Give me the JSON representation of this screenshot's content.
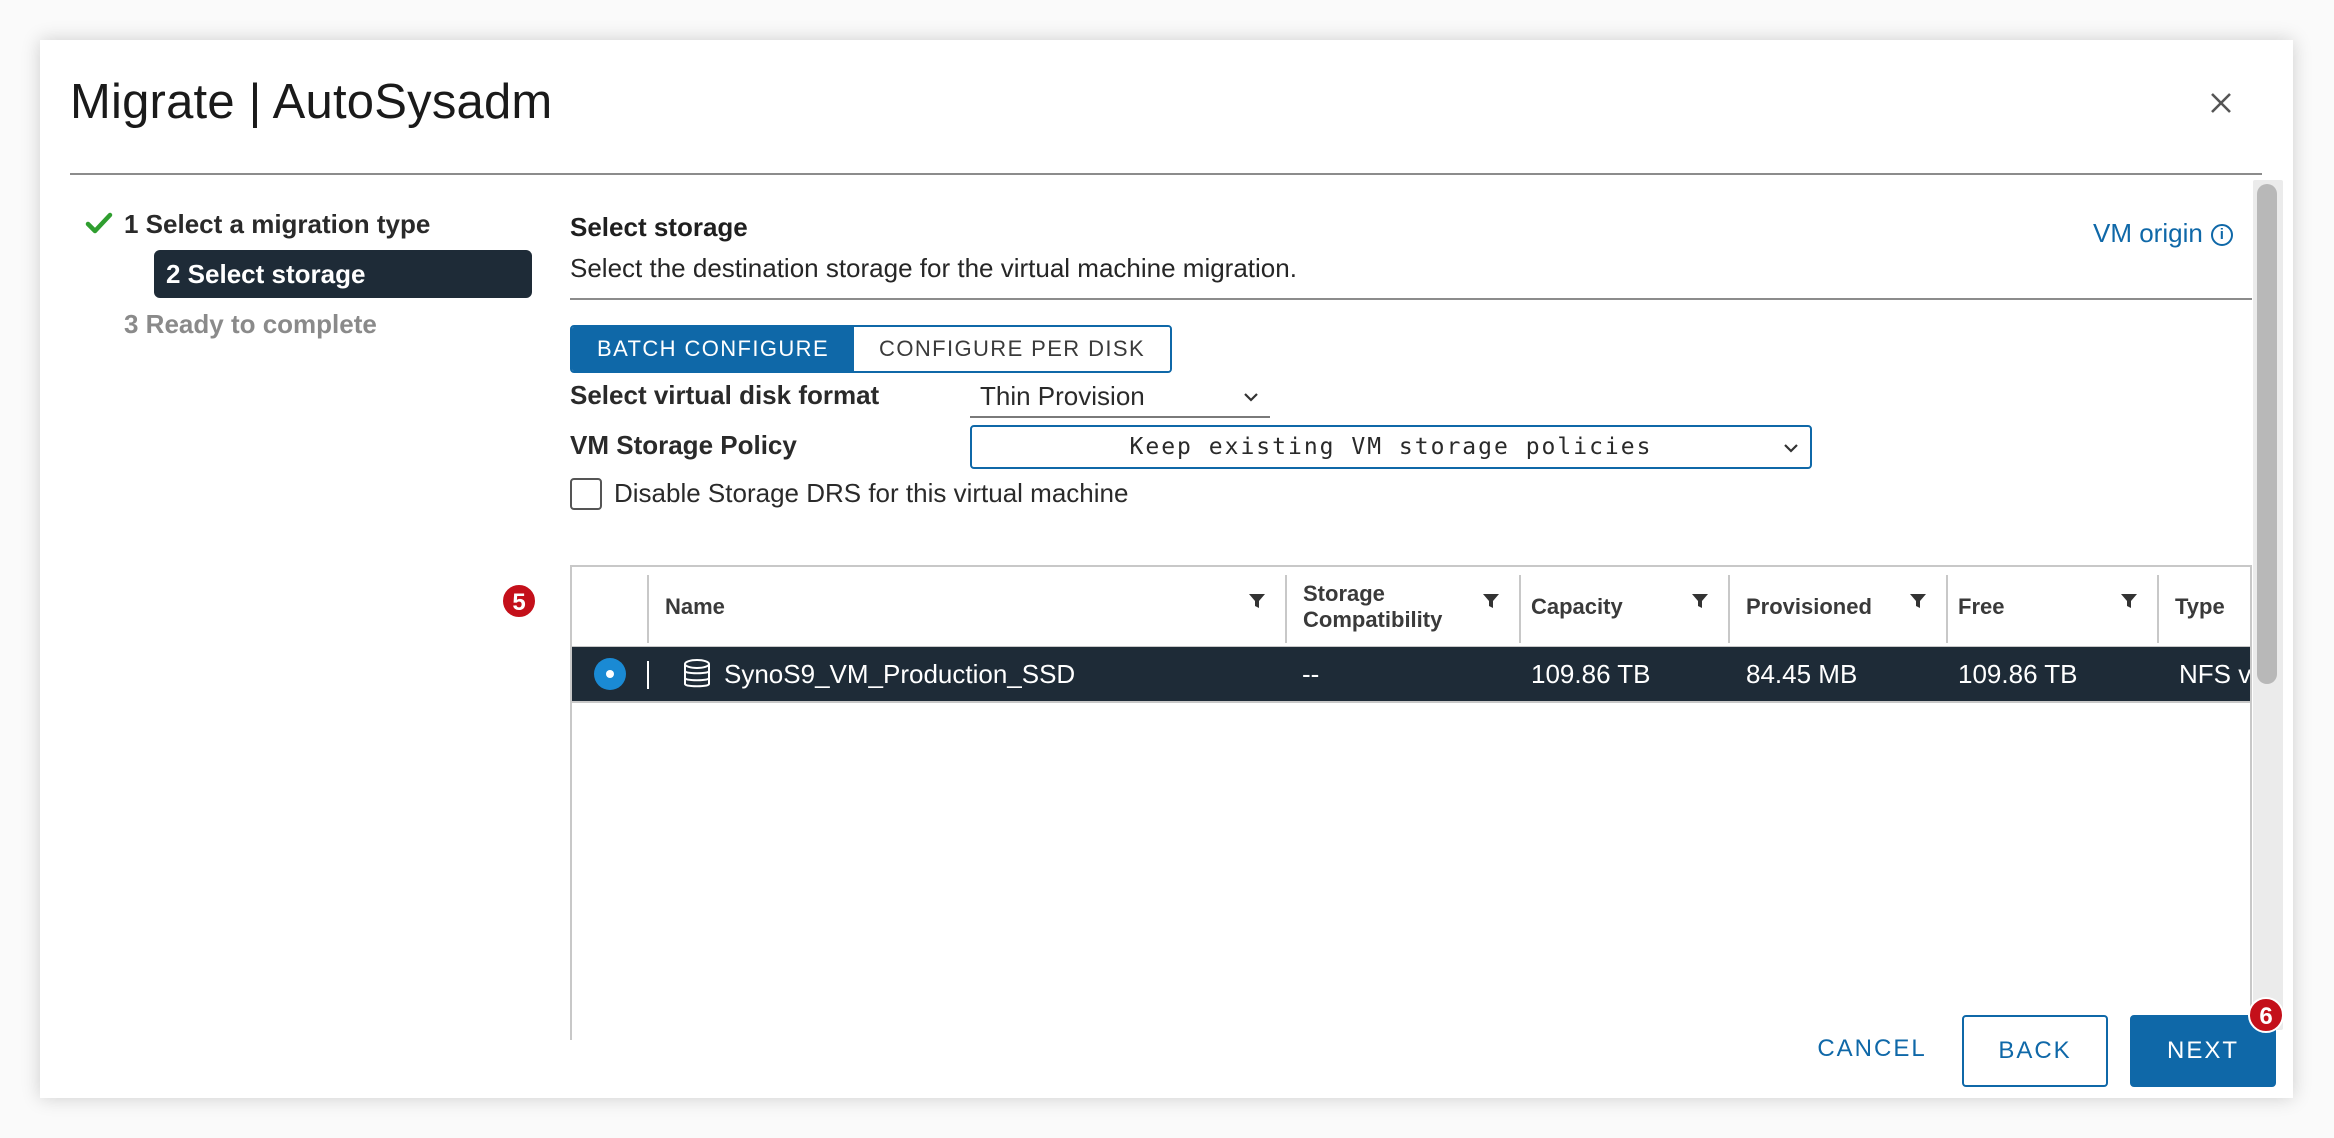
{
  "dialog": {
    "title": "Migrate | AutoSysadm",
    "close_icon": "close-icon"
  },
  "steps": [
    {
      "label": "1 Select a migration type",
      "state": "done",
      "icon": "checkmark-icon"
    },
    {
      "label": "2 Select storage",
      "state": "active"
    },
    {
      "label": "3 Ready to complete",
      "state": "pending"
    }
  ],
  "content": {
    "title": "Select storage",
    "subtitle": "Select the destination storage for the virtual machine migration.",
    "vm_origin": "VM origin",
    "tabs": {
      "batch": "BATCH CONFIGURE",
      "per_disk": "CONFIGURE PER DISK"
    },
    "disk_format": {
      "label": "Select virtual disk format",
      "value": "Thin Provision"
    },
    "storage_policy": {
      "label": "VM Storage Policy",
      "value": "Keep existing VM storage policies"
    },
    "disable_drs": {
      "label": "Disable Storage DRS for this virtual machine",
      "checked": false
    }
  },
  "grid": {
    "columns": [
      "Name",
      "Storage Compatibility",
      "Capacity",
      "Provisioned",
      "Free",
      "Type"
    ],
    "rows": [
      {
        "selected": true,
        "name": "SynoS9_VM_Production_SSD",
        "compatibility": "--",
        "capacity": "109.86 TB",
        "provisioned": "84.45 MB",
        "free": "109.86 TB",
        "type": "NFS v"
      }
    ]
  },
  "badges": {
    "row": "5",
    "next": "6"
  },
  "footer": {
    "cancel": "CANCEL",
    "back": "BACK",
    "next": "NEXT"
  },
  "colors": {
    "accent": "#0f68a8",
    "selected_row": "#1e2b37",
    "success": "#2f9e2f",
    "badge": "#c4101a"
  }
}
